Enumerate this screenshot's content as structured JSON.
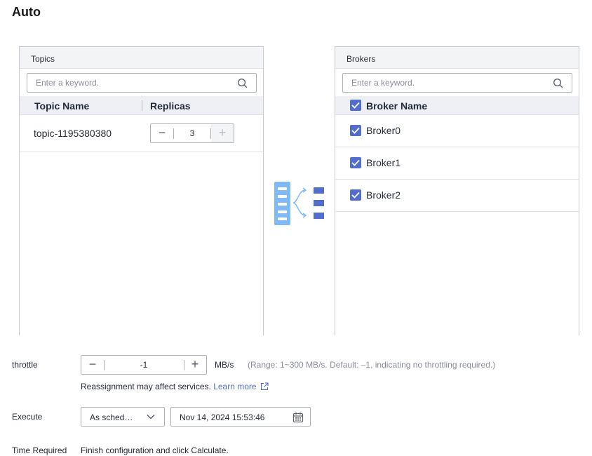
{
  "page": {
    "title": "Auto"
  },
  "topics": {
    "header": "Topics",
    "search_placeholder": "Enter a keyword.",
    "columns": [
      "Topic Name",
      "Replicas"
    ],
    "rows": [
      {
        "name": "topic-1195380380",
        "replicas": "3"
      }
    ]
  },
  "brokers": {
    "header": "Brokers",
    "search_placeholder": "Enter a keyword.",
    "column": "Broker Name",
    "items": [
      {
        "name": "Broker0",
        "checked": true
      },
      {
        "name": "Broker1",
        "checked": true
      },
      {
        "name": "Broker2",
        "checked": true
      }
    ]
  },
  "form": {
    "throttle": {
      "label": "throttle",
      "value": "-1",
      "unit": "MB/s",
      "hint": "(Range: 1~300 MB/s. Default: –1, indicating no throttling required.)",
      "warning": "Reassignment may affect services.",
      "learn_more": "Learn more"
    },
    "execute": {
      "label": "Execute",
      "mode": "As sched…",
      "datetime": "Nov 14, 2024 15:53:46"
    },
    "time_required": {
      "label": "Time Required",
      "value": "Finish configuration and click Calculate."
    }
  },
  "colors": {
    "accent": "#526ecc",
    "icon_light": "#7fbaf7",
    "border": "#adb0b8"
  },
  "icons": [
    "search-icon",
    "minus-icon",
    "plus-icon",
    "checkbox-checked-icon",
    "transfer-icon",
    "external-link-icon",
    "chevron-down-icon",
    "calendar-icon"
  ]
}
